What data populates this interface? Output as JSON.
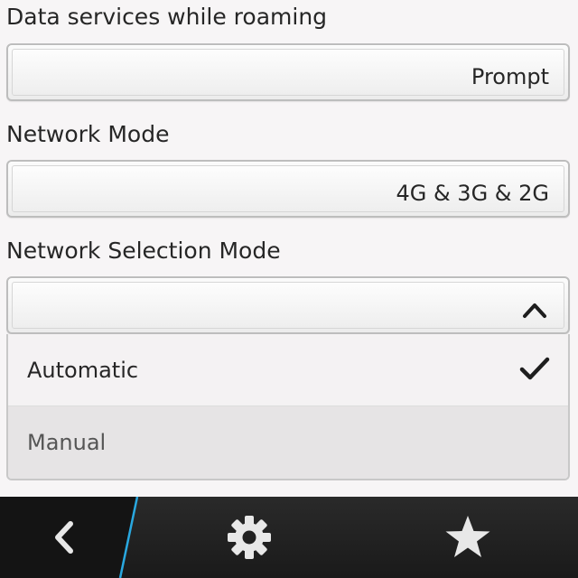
{
  "settings": {
    "data_roaming": {
      "label": "Data services while roaming",
      "value": "Prompt"
    },
    "network_mode": {
      "label": "Network Mode",
      "value": "4G & 3G & 2G"
    },
    "network_selection": {
      "label": "Network Selection Mode",
      "expanded": true,
      "options": [
        {
          "label": "Automatic",
          "selected": true
        },
        {
          "label": "Manual",
          "selected": false
        }
      ]
    }
  },
  "bottom_bar": {
    "icons": [
      "back-icon",
      "gear-icon",
      "star-icon"
    ],
    "accent_color": "#29a8e0"
  }
}
